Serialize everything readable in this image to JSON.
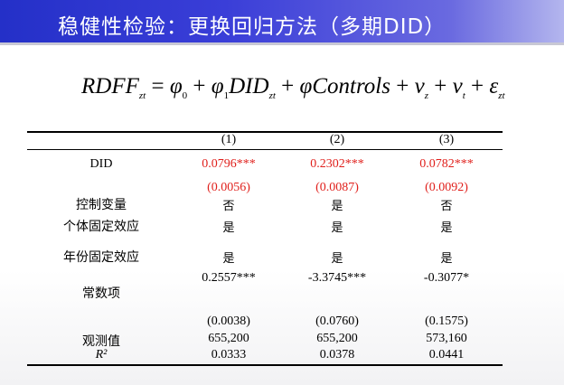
{
  "slide": {
    "title": "稳健性检验：更换回归方法（多期DID）"
  },
  "formula": {
    "lhs": "RDFF",
    "lhs_sub": "zt",
    "eq": " = ",
    "phi0": "φ",
    "phi0_sub": "0",
    "plus1": " + ",
    "phi1": "φ",
    "phi1_sub": "1",
    "did": "DID",
    "did_sub": "zt",
    "plus2": " + ",
    "phi_c": "φ",
    "controls": "Controls",
    "plus3": " + ",
    "nu1": "ν",
    "nu1_sub": "z",
    "plus4": " + ",
    "nu2": "ν",
    "nu2_sub": "t",
    "plus5": " + ",
    "eps": "ε",
    "eps_sub": "zt"
  },
  "table": {
    "columns": [
      "(1)",
      "(2)",
      "(3)"
    ],
    "did": {
      "label": "DID",
      "coef": [
        "0.0796***",
        "0.2302***",
        "0.0782***"
      ],
      "se": [
        "(0.0056)",
        "(0.0087)",
        "(0.0092)"
      ]
    },
    "controls": {
      "label": "控制变量",
      "values": [
        "否",
        "是",
        "否"
      ]
    },
    "individual_fe": {
      "label": "个体固定效应",
      "values": [
        "是",
        "是",
        "是"
      ]
    },
    "year_fe": {
      "label": "年份固定效应",
      "values": [
        "是",
        "是",
        "是"
      ]
    },
    "constant": {
      "label": "常数项",
      "coef": [
        "0.2557***",
        "-3.3745***",
        "-0.3077*"
      ],
      "se": [
        "(0.0038)",
        "(0.0760)",
        "(0.1575)"
      ]
    },
    "obs": {
      "label": "观测值",
      "values": [
        "655,200",
        "655,200",
        "573,160"
      ]
    },
    "r2": {
      "label": "R²",
      "values": [
        "0.0333",
        "0.0378",
        "0.0441"
      ]
    }
  },
  "colors": {
    "title_bar": "#2430c8",
    "significant": "#e0201c"
  }
}
